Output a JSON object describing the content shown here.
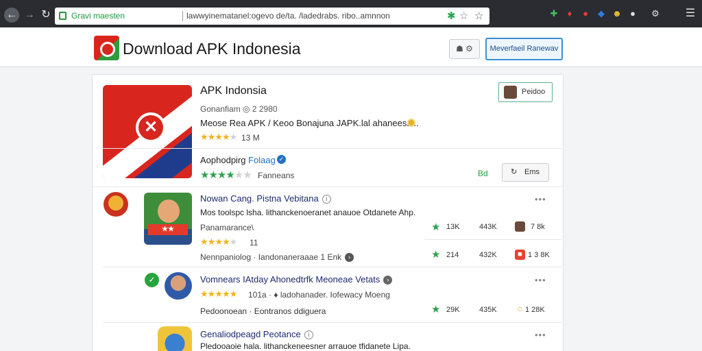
{
  "browser": {
    "secure_label": "Gravi maesten",
    "url": "lawwyinematanel:ogevo de/ta. /ladedrabs. ribo..amnnon",
    "icons": [
      "back-icon",
      "forward-icon",
      "reload-icon",
      "lock-icon",
      "extension-icon",
      "star-icon",
      "puzzle-icon",
      "shield-icon",
      "flag-icon",
      "circle-icon",
      "emoji-icon",
      "gear-icon",
      "menu-icon"
    ]
  },
  "header": {
    "site_title": "Download APK Indonesia",
    "user_button": "☗ ⚙",
    "cta_button": "Meverfaeil Ranewav"
  },
  "featured": {
    "title": "APK Indonsia",
    "meta": "Gonanfiam ◎ 2 2980",
    "description": "Meose Rea APK / Keoo Bonajuna JAPK.lal ahaneess...",
    "rating_text": "13 M",
    "developer_prefix": "Aophodpirg",
    "developer_link": "Folaag",
    "second_rating_text": "Fanneans",
    "follow_label": "Peidoo",
    "price": "Bd",
    "install_label": "Ems",
    "colors": {
      "accent": "#2ba24c",
      "link": "#2271c9",
      "brand_red": "#d8261f"
    }
  },
  "rows": [
    {
      "title": "Nowan Cang. Pistna Vebitana",
      "description": "Mos toolspc lsha. lithanckenoeranet anauoe Otdanete Ahp.",
      "sub_a": "Panamarance\\",
      "rating_text": "11",
      "sub_b": "Nennpaniolog · Iandonaneraaae 1 Enk",
      "stat_rating": "13K",
      "stat_downloads": "443K",
      "stat_extra": "7 8k"
    },
    {
      "title": "Vomnears IAtday Ahonedtrfk Meoneae Vetats",
      "rating_text": "101a · ♦ ladohanader. Iofewacy Moeng",
      "sub_b": "Pedoonoean · Eontranos ddiguera",
      "stat_rating": "214",
      "stat_downloads": "432K",
      "stat_extra": "1 3 8K",
      "stat_rating_2": "29K",
      "stat_downloads_2": "435K",
      "stat_extra_2": "1 28K"
    },
    {
      "title": "Genaliodpeagd Peotance",
      "description": "Pledooaoie hala. lithanckeneesner arrauoe tfidanete Lipa."
    }
  ]
}
